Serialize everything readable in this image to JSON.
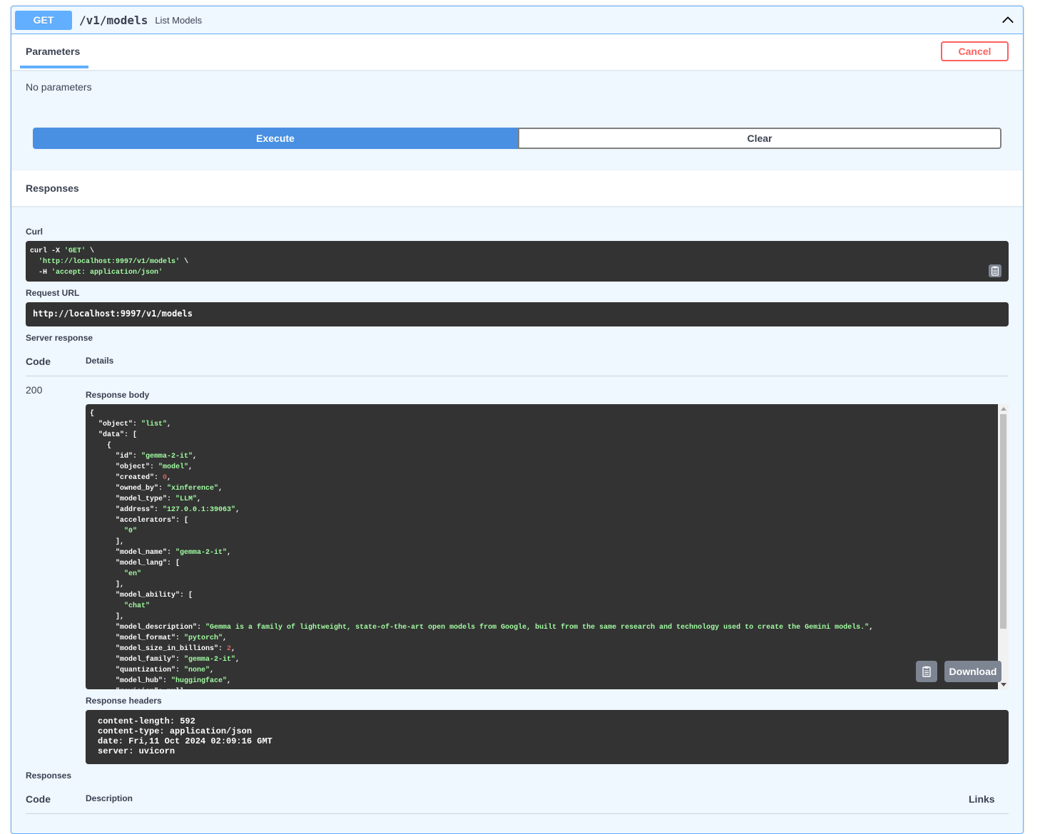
{
  "summary": {
    "method": "GET",
    "path": "/v1/models",
    "description": "List Models"
  },
  "parameters": {
    "tab_label": "Parameters",
    "cancel_label": "Cancel",
    "empty_text": "No parameters"
  },
  "actions": {
    "execute_label": "Execute",
    "clear_label": "Clear"
  },
  "responses_section": {
    "title": "Responses",
    "curl_label": "Curl",
    "curl": {
      "line1_cmd": "curl -X ",
      "line1_method": "'GET'",
      "line1_tail": " \\",
      "line2_url": "'http://localhost:9997/v1/models'",
      "line2_tail": " \\",
      "line3_flag": "  -H ",
      "line3_header": "'accept: application/json'"
    },
    "request_url_label": "Request URL",
    "request_url": "http://localhost:9997/v1/models",
    "server_response_label": "Server response",
    "col_code": "Code",
    "col_details": "Details",
    "status_code": "200",
    "response_body_label": "Response body",
    "download_label": "Download",
    "response_headers_label": "Response headers",
    "response_headers": [
      "content-length: 592",
      "content-type: application/json",
      "date: Fri,11 Oct 2024 02:09:16 GMT",
      "server: uvicorn"
    ]
  },
  "response_body": [
    {
      "t": "{",
      "c": "w"
    },
    {
      "k": "  \"object\": ",
      "v": "\"list\"",
      "e": ",",
      "c": "s"
    },
    {
      "k": "  \"data\": [",
      "v": "",
      "e": "",
      "c": "w"
    },
    {
      "k": "    {",
      "v": "",
      "e": "",
      "c": "w"
    },
    {
      "k": "      \"id\": ",
      "v": "\"gemma-2-it\"",
      "e": ",",
      "c": "s"
    },
    {
      "k": "      \"object\": ",
      "v": "\"model\"",
      "e": ",",
      "c": "s"
    },
    {
      "k": "      \"created\": ",
      "v": "0",
      "e": ",",
      "c": "n"
    },
    {
      "k": "      \"owned_by\": ",
      "v": "\"xinference\"",
      "e": ",",
      "c": "s"
    },
    {
      "k": "      \"model_type\": ",
      "v": "\"LLM\"",
      "e": ",",
      "c": "s"
    },
    {
      "k": "      \"address\": ",
      "v": "\"127.0.0.1:39063\"",
      "e": ",",
      "c": "s"
    },
    {
      "k": "      \"accelerators\": [",
      "v": "",
      "e": "",
      "c": "w"
    },
    {
      "k": "        ",
      "v": "\"0\"",
      "e": "",
      "c": "s"
    },
    {
      "k": "      ],",
      "v": "",
      "e": "",
      "c": "w"
    },
    {
      "k": "      \"model_name\": ",
      "v": "\"gemma-2-it\"",
      "e": ",",
      "c": "s"
    },
    {
      "k": "      \"model_lang\": [",
      "v": "",
      "e": "",
      "c": "w"
    },
    {
      "k": "        ",
      "v": "\"en\"",
      "e": "",
      "c": "s"
    },
    {
      "k": "      ],",
      "v": "",
      "e": "",
      "c": "w"
    },
    {
      "k": "      \"model_ability\": [",
      "v": "",
      "e": "",
      "c": "w"
    },
    {
      "k": "        ",
      "v": "\"chat\"",
      "e": "",
      "c": "s"
    },
    {
      "k": "      ],",
      "v": "",
      "e": "",
      "c": "w"
    },
    {
      "k": "      \"model_description\": ",
      "v": "\"Gemma is a family of lightweight, state-of-the-art open models from Google, built from the same research and technology used to create the Gemini models.\"",
      "e": ",",
      "c": "s"
    },
    {
      "k": "      \"model_format\": ",
      "v": "\"pytorch\"",
      "e": ",",
      "c": "s"
    },
    {
      "k": "      \"model_size_in_billions\": ",
      "v": "2",
      "e": ",",
      "c": "n"
    },
    {
      "k": "      \"model_family\": ",
      "v": "\"gemma-2-it\"",
      "e": ",",
      "c": "s"
    },
    {
      "k": "      \"quantization\": ",
      "v": "\"none\"",
      "e": ",",
      "c": "s"
    },
    {
      "k": "      \"model_hub\": ",
      "v": "\"huggingface\"",
      "e": ",",
      "c": "s"
    },
    {
      "k": "      \"revision\": ",
      "v": "null",
      "e": ",",
      "c": "w"
    }
  ],
  "lower_responses": {
    "title": "Responses",
    "col_code": "Code",
    "col_description": "Description",
    "col_links": "Links"
  },
  "colors": {
    "accent": "#61affe",
    "execute": "#4990e2",
    "cancel": "#ff6060",
    "code_bg": "#333333",
    "string": "#a2fca2",
    "number": "#d36363"
  },
  "icons": [
    "chevron-up-icon",
    "copy-icon"
  ]
}
